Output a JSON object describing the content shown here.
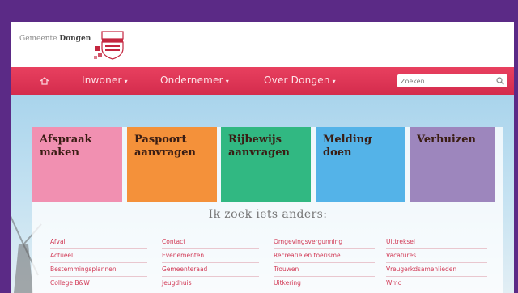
{
  "header": {
    "municipality_prefix": "Gemeente",
    "municipality_name": "Dongen"
  },
  "nav": {
    "items": [
      {
        "label": "Inwoner"
      },
      {
        "label": "Ondernemer"
      },
      {
        "label": "Over Dongen"
      }
    ],
    "search_placeholder": "Zoeken"
  },
  "tiles": [
    {
      "line1": "Afspraak",
      "line2": "maken",
      "color": "#f190b1"
    },
    {
      "line1": "Paspoort",
      "line2": "aanvragen",
      "color": "#f4913a"
    },
    {
      "line1": "Rijbewijs",
      "line2": "aanvragen",
      "color": "#31b882"
    },
    {
      "line1": "Melding",
      "line2": "doen",
      "color": "#54b3e8"
    },
    {
      "line1": "Verhuizen",
      "line2": "",
      "color": "#9d86bd"
    }
  ],
  "links_heading": "Ik zoek iets anders:",
  "link_columns": [
    [
      "Afval",
      "Actueel",
      "Bestemmingsplannen",
      "College B&W"
    ],
    [
      "Contact",
      "Evenementen",
      "Gemeenteraad",
      "Jeugdhuis"
    ],
    [
      "Omgevingsvergunning",
      "Recreatie en toerisme",
      "Trouwen",
      "Uitkering"
    ],
    [
      "Uittreksel",
      "Vacatures",
      "Vreugerkdsamenlieden",
      "Wmo"
    ]
  ],
  "colors": {
    "frame": "#5b2a86",
    "navbar": "#e0365a",
    "link": "#d23a56"
  },
  "icons": [
    "home-icon",
    "search-icon",
    "crest-icon"
  ]
}
